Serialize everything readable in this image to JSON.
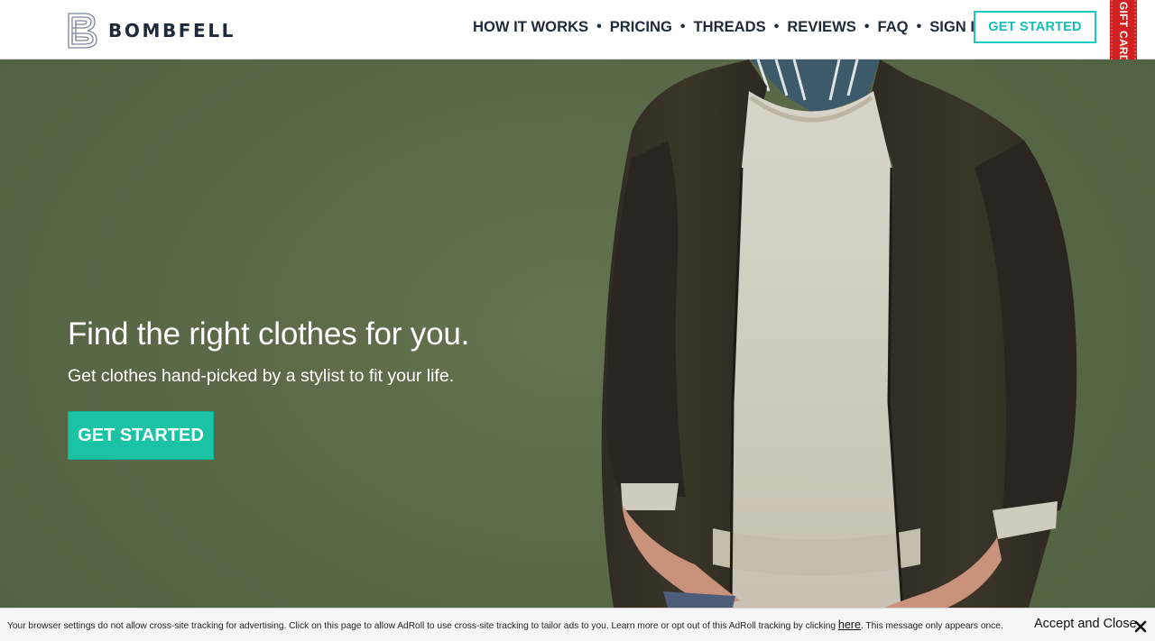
{
  "header": {
    "logo_text": "BOMBFELL",
    "nav": [
      {
        "label": "HOW IT WORKS"
      },
      {
        "label": "PRICING"
      },
      {
        "label": "THREADS"
      },
      {
        "label": "REVIEWS"
      },
      {
        "label": "FAQ"
      },
      {
        "label": "SIGN IN"
      }
    ],
    "nav_separator": "•",
    "cta_label": "GET STARTED",
    "ribbon_label": "GIFT CARDS"
  },
  "hero": {
    "title": "Find the right clothes for you.",
    "subtitle": "Get clothes hand-picked by a stylist to fit your life.",
    "cta_label": "GET STARTED"
  },
  "cookie_banner": {
    "text_before": "Your browser settings do not allow cross-site tracking for advertising. Click on this page to allow AdRoll to use cross-site tracking to tailor ads to you. Learn more or opt out of this AdRoll tracking by clicking ",
    "link_text": "here",
    "text_after": ". This message only appears once.",
    "accept_label": "Accept and Close"
  },
  "colors": {
    "brand_navy": "#1e2a3a",
    "accent_teal": "#1cc8c0",
    "cta_green": "#19c3a4",
    "ribbon_red": "#d0201f",
    "hero_bg": "#5a6a48"
  },
  "icons": {
    "logo": "bombfell-b-logo-icon",
    "close": "close-icon"
  }
}
